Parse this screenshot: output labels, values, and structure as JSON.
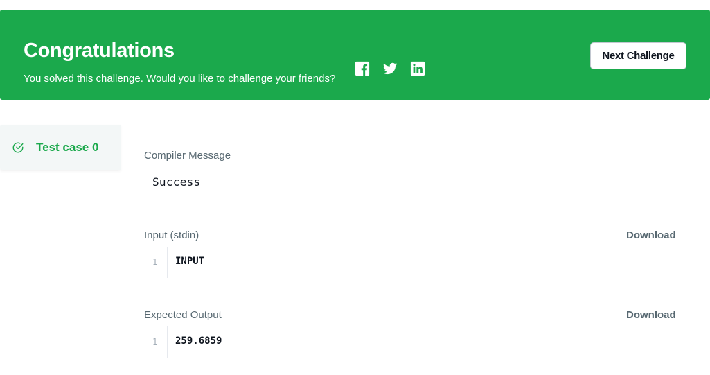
{
  "banner": {
    "title": "Congratulations",
    "subtitle": "You solved this challenge. Would you like to challenge your friends?",
    "share_icons": [
      "facebook-icon",
      "twitter-icon",
      "linkedin-icon"
    ],
    "next_button_label": "Next Challenge",
    "color": "#1ba94c"
  },
  "sidebar": {
    "tabs": [
      {
        "label": "Test case 0",
        "status": "passed",
        "icon": "check-circle-icon"
      }
    ]
  },
  "result": {
    "compiler_message_label": "Compiler Message",
    "compiler_message": "Success",
    "input": {
      "label": "Input (stdin)",
      "download_label": "Download",
      "lines": [
        {
          "number": "1",
          "text": "INPUT"
        }
      ]
    },
    "expected_output": {
      "label": "Expected Output",
      "download_label": "Download",
      "lines": [
        {
          "number": "1",
          "text": "259.6859"
        }
      ]
    }
  }
}
